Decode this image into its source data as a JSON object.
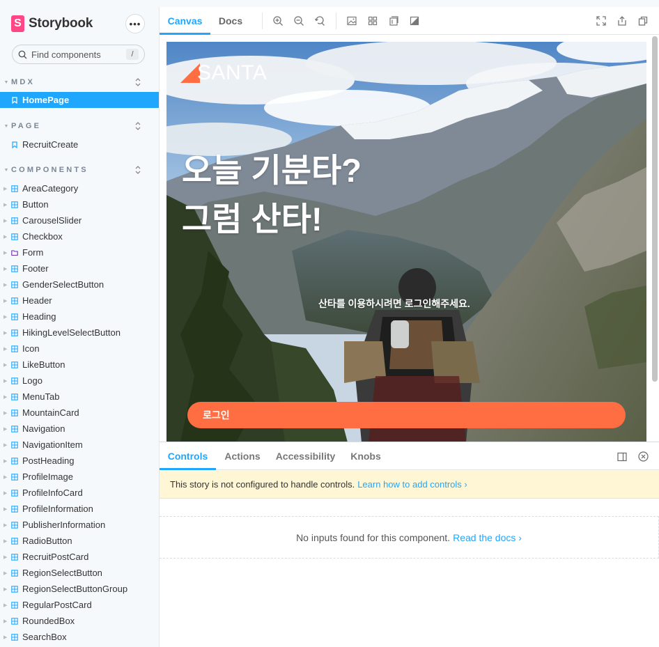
{
  "sidebar": {
    "brand": "Storybook",
    "menu_glyph": "•••",
    "search": {
      "placeholder": "Find components",
      "shortcut": "/"
    },
    "sections": {
      "mdx": {
        "title": "MDX",
        "items": [
          "HomePage"
        ]
      },
      "page": {
        "title": "PAGE",
        "items": [
          "RecruitCreate"
        ]
      },
      "components": {
        "title": "COMPONENTS",
        "items": [
          "AreaCategory",
          "Button",
          "CarouselSlider",
          "Checkbox",
          "Form",
          "Footer",
          "GenderSelectButton",
          "Header",
          "Heading",
          "HikingLevelSelectButton",
          "Icon",
          "LikeButton",
          "Logo",
          "MenuTab",
          "MountainCard",
          "Navigation",
          "NavigationItem",
          "PostHeading",
          "ProfileImage",
          "ProfileInfoCard",
          "ProfileInformation",
          "PublisherInformation",
          "RadioButton",
          "RecruitPostCard",
          "RegionSelectButton",
          "RegionSelectButtonGroup",
          "RegularPostCard",
          "RoundedBox",
          "SearchBox"
        ]
      }
    },
    "selected": "HomePage"
  },
  "toolbar": {
    "tabs": [
      "Canvas",
      "Docs"
    ],
    "active_tab": "Canvas"
  },
  "preview": {
    "logo_text": "SANTA",
    "title_line1": "오늘 기분타?",
    "title_line2": "그럼 산타!",
    "subtitle": "산타를 이용하시려면 로그인해주세요.",
    "login_button": "로그인"
  },
  "addons": {
    "tabs": [
      "Controls",
      "Actions",
      "Accessibility",
      "Knobs"
    ],
    "active_tab": "Controls",
    "warning_text": "This story is not configured to handle controls.",
    "warning_link": "Learn how to add controls ›",
    "empty_text": "No inputs found for this component.",
    "empty_link": "Read the docs ›"
  },
  "colors": {
    "accent": "#1ea7fd",
    "storybook_pink": "#ff4785",
    "santa_orange": "#ff6d42",
    "warning_bg": "#fff6d6"
  }
}
